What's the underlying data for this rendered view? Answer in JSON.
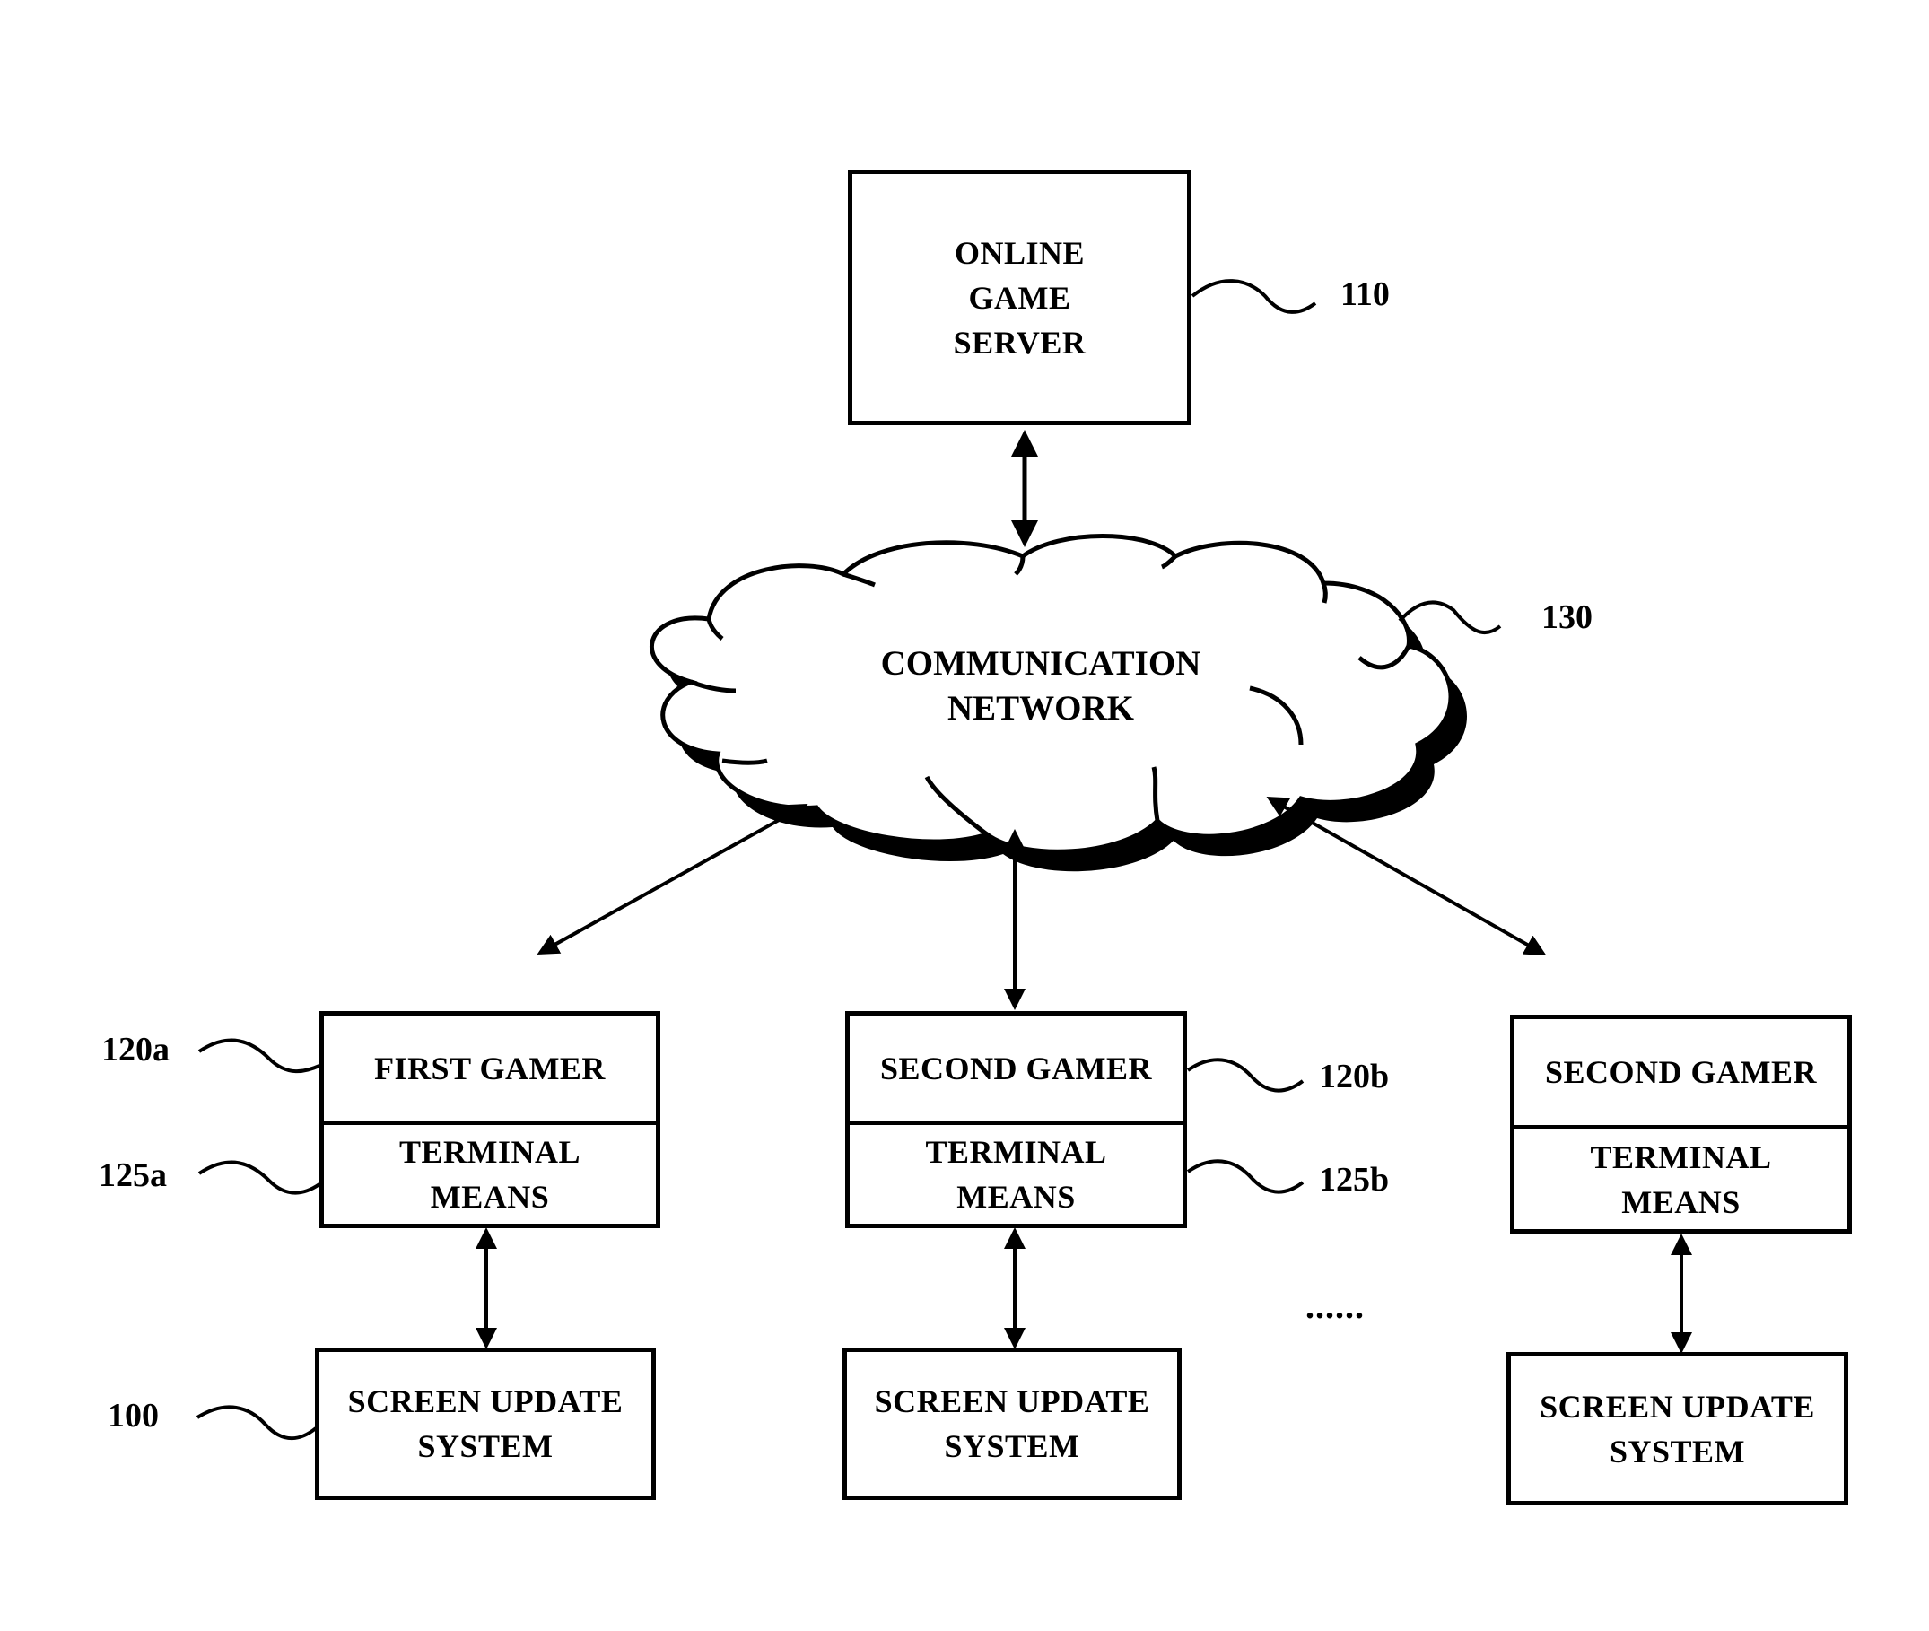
{
  "figure": {
    "server": {
      "label": "ONLINE\nGAME\nSERVER",
      "ref": "110"
    },
    "network": {
      "label": "COMMUNICATION\nNETWORK",
      "ref": "130"
    },
    "terminals": [
      {
        "gamer_label": "FIRST GAMER",
        "terminal_label": "TERMINAL\nMEANS",
        "gamer_ref": "120a",
        "terminal_ref": "125a",
        "screen_update_label": "SCREEN UPDATE\nSYSTEM",
        "screen_update_ref": "100"
      },
      {
        "gamer_label": "SECOND GAMER",
        "terminal_label": "TERMINAL\nMEANS",
        "gamer_ref": "120b",
        "terminal_ref": "125b",
        "screen_update_label": "SCREEN UPDATE\nSYSTEM"
      },
      {
        "gamer_label": "SECOND GAMER",
        "terminal_label": "TERMINAL\nMEANS",
        "screen_update_label": "SCREEN UPDATE\nSYSTEM"
      }
    ],
    "ellipsis": "......"
  }
}
